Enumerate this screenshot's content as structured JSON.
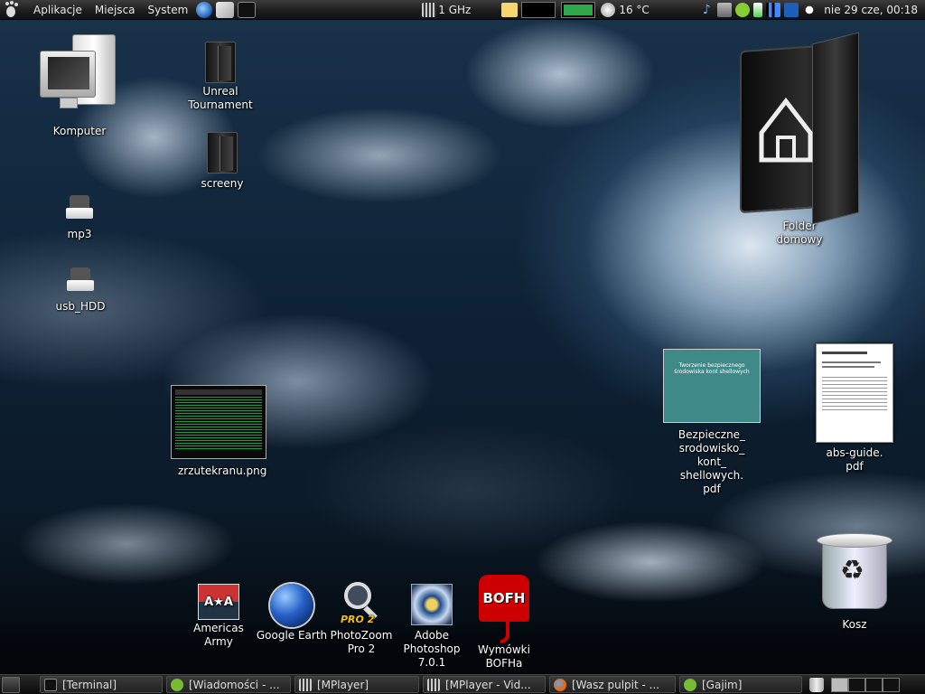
{
  "top_panel": {
    "menus": [
      "Aplikacje",
      "Miejsca",
      "System"
    ],
    "cpu_freq": "1 GHz",
    "temperature": "16 °C",
    "clock": "nie 29 cze, 00:18"
  },
  "desktop": {
    "icons": {
      "computer": "Komputer",
      "unreal": "Unreal Tournament",
      "screeny": "screeny",
      "mp3": "mp3",
      "usb_hdd": "usb_HDD",
      "home_folder": "Folder domowy",
      "screenshot_file": "zrzutekranu.png",
      "pdf_bezpieczne": "Bezpieczne_ srodowisko_ kont_ shellowych. pdf",
      "pdf_abs_guide": "abs-guide. pdf",
      "americas_army": "Americas Army",
      "google_earth": "Google Earth",
      "photozoom": "PhotoZoom Pro 2",
      "photoshop": "Adobe Photoshop 7.0.1",
      "bofh": "Wymówki BOFHa",
      "trash": "Kosz"
    },
    "pdf_thumb_lines": [
      "Tworzenie bezpiecznego",
      "środowiska kont shellowych"
    ],
    "bofh_logo_text": "BOFH",
    "photozoom_logo_text": "PRO 2",
    "aa_logo_text": "A★A"
  },
  "taskbar": {
    "tasks": [
      "[Terminal]",
      "[Wiadomości - ...",
      "[MPlayer]",
      "[MPlayer - Vid...",
      "[Wasz pulpit - ...",
      "[Gajim]"
    ]
  },
  "colors": {
    "panel_bg": "#1e1e1e",
    "wallpaper_dark": "#0b1a28",
    "network_green": "#2ea84a"
  }
}
